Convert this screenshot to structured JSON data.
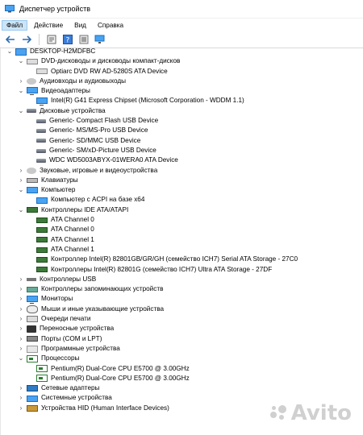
{
  "window": {
    "title": "Диспетчер устройств"
  },
  "menu": {
    "items": [
      "Файл",
      "Действие",
      "Вид",
      "Справка"
    ],
    "active": "Файл"
  },
  "toolbar": {
    "buttons": [
      "back-arrow-icon",
      "forward-arrow-icon",
      "properties-icon",
      "help-icon",
      "show-hidden-icon",
      "scan-hardware-icon"
    ]
  },
  "tree": {
    "root": "DESKTOP-H2MDFBC",
    "rows": [
      {
        "level": 1,
        "expanded": true,
        "icon": "optical-drive-icon",
        "label": "DVD-дисководы и дисководы компакт-дисков"
      },
      {
        "level": 2,
        "icon": "optical-drive-icon",
        "label": "Optiarc DVD RW AD-5280S ATA Device"
      },
      {
        "level": 1,
        "expanded": false,
        "icon": "audio-icon",
        "label": "Аудиовходы и аудиовыходы"
      },
      {
        "level": 1,
        "expanded": true,
        "icon": "display-adapter-icon",
        "label": "Видеоадаптеры"
      },
      {
        "level": 2,
        "icon": "display-adapter-icon",
        "label": "Intel(R) G41 Express Chipset (Microsoft Corporation - WDDM 1.1)"
      },
      {
        "level": 1,
        "expanded": true,
        "icon": "disk-drive-icon",
        "label": "Дисковые устройства"
      },
      {
        "level": 2,
        "icon": "disk-drive-icon",
        "label": "Generic- Compact Flash USB Device"
      },
      {
        "level": 2,
        "icon": "disk-drive-icon",
        "label": "Generic- MS/MS-Pro USB Device"
      },
      {
        "level": 2,
        "icon": "disk-drive-icon",
        "label": "Generic- SD/MMC USB Device"
      },
      {
        "level": 2,
        "icon": "disk-drive-icon",
        "label": "Generic- SM/xD-Picture USB Device"
      },
      {
        "level": 2,
        "icon": "disk-drive-icon",
        "label": "WDC WD5003ABYX-01WERA0 ATA Device"
      },
      {
        "level": 1,
        "expanded": false,
        "icon": "sound-icon",
        "label": "Звуковые, игровые и видеоустройства"
      },
      {
        "level": 1,
        "expanded": false,
        "icon": "keyboard-icon",
        "label": "Клавиатуры"
      },
      {
        "level": 1,
        "expanded": true,
        "icon": "computer-icon",
        "label": "Компьютер"
      },
      {
        "level": 2,
        "icon": "computer-icon",
        "label": "Компьютер с ACPI на базе x64"
      },
      {
        "level": 1,
        "expanded": true,
        "icon": "ide-controller-icon",
        "label": "Контроллеры IDE ATA/ATAPI"
      },
      {
        "level": 2,
        "icon": "ide-controller-icon",
        "label": "ATA Channel 0"
      },
      {
        "level": 2,
        "icon": "ide-controller-icon",
        "label": "ATA Channel 0"
      },
      {
        "level": 2,
        "icon": "ide-controller-icon",
        "label": "ATA Channel 1"
      },
      {
        "level": 2,
        "icon": "ide-controller-icon",
        "label": "ATA Channel 1"
      },
      {
        "level": 2,
        "icon": "ide-controller-icon",
        "label": "Контроллер Intel(R) 82801GB/GR/GH (семейство ICH7) Serial ATA Storage - 27C0"
      },
      {
        "level": 2,
        "icon": "ide-controller-icon",
        "label": "Контроллеры Intel(R) 82801G (семейство ICH7) Ultra ATA Storage - 27DF"
      },
      {
        "level": 1,
        "expanded": false,
        "icon": "usb-icon",
        "label": "Контроллеры USB"
      },
      {
        "level": 1,
        "expanded": false,
        "icon": "storage-controller-icon",
        "label": "Контроллеры запоминающих устройств"
      },
      {
        "level": 1,
        "expanded": false,
        "icon": "monitor-icon",
        "label": "Мониторы"
      },
      {
        "level": 1,
        "expanded": false,
        "icon": "mouse-icon",
        "label": "Мыши и иные указывающие устройства"
      },
      {
        "level": 1,
        "expanded": false,
        "icon": "print-queue-icon",
        "label": "Очереди печати"
      },
      {
        "level": 1,
        "expanded": false,
        "icon": "portable-device-icon",
        "label": "Переносные устройства"
      },
      {
        "level": 1,
        "expanded": false,
        "icon": "port-icon",
        "label": "Порты (COM и LPT)"
      },
      {
        "level": 1,
        "expanded": false,
        "icon": "software-device-icon",
        "label": "Программные устройства"
      },
      {
        "level": 1,
        "expanded": true,
        "icon": "processor-icon",
        "label": "Процессоры"
      },
      {
        "level": 2,
        "icon": "processor-icon",
        "label": "Pentium(R) Dual-Core  CPU      E5700  @ 3.00GHz"
      },
      {
        "level": 2,
        "icon": "processor-icon",
        "label": "Pentium(R) Dual-Core  CPU      E5700  @ 3.00GHz"
      },
      {
        "level": 1,
        "expanded": false,
        "icon": "network-adapter-icon",
        "label": "Сетевые адаптеры"
      },
      {
        "level": 1,
        "expanded": false,
        "icon": "system-device-icon",
        "label": "Системные устройства"
      },
      {
        "level": 1,
        "expanded": false,
        "icon": "hid-icon",
        "label": "Устройства HID (Human Interface Devices)"
      }
    ]
  },
  "watermark": {
    "text": "Avito"
  }
}
